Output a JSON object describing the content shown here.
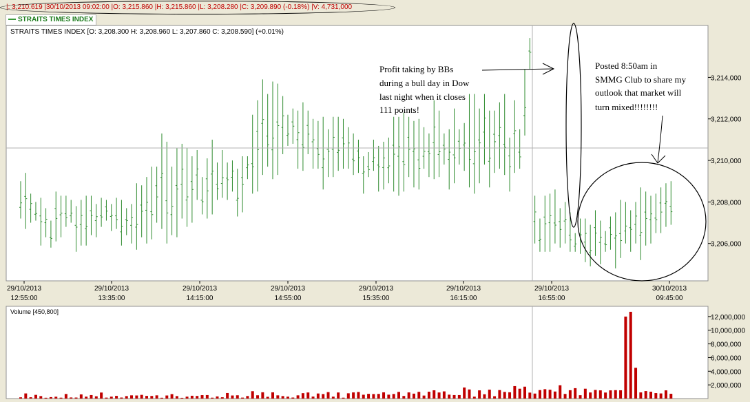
{
  "header": {
    "info_line": "|: 3,210.619 |30/10/2013 09:02:00 |O: 3,215.860 |H: 3,215.860 |L: 3,208.280 |C: 3,209.890 (-0.18%) |V: 4,731,000",
    "legend_tag": "STRAITS TIMES INDEX"
  },
  "price_panel": {
    "title": "STRAITS TIMES INDEX [O: 3,208.300  H: 3,208.960  L: 3,207.860  C: 3,208.590] (+0.01%)"
  },
  "volume_panel": {
    "title": "Volume [450,800]"
  },
  "annotations": {
    "left": [
      "Profit taking by BBs",
      "during a bull day in Dow",
      "last night when it closes",
      "111 points!"
    ],
    "right": [
      "Posted 8:50am in",
      "SMMG Club to share my",
      "outlook that market will",
      "turn mixed!!!!!!!!"
    ]
  },
  "colors": {
    "price_bar": "#2e8b2e",
    "volume_bar": "#c00000",
    "background": "#ffffff",
    "frame": "#ece9d8"
  },
  "chart_data": [
    {
      "type": "ohlc",
      "title": "STRAITS TIMES INDEX",
      "x_tick_labels": [
        [
          "29/10/2013",
          "12:55:00"
        ],
        [
          "29/10/2013",
          "13:35:00"
        ],
        [
          "29/10/2013",
          "14:15:00"
        ],
        [
          "29/10/2013",
          "14:55:00"
        ],
        [
          "29/10/2013",
          "15:35:00"
        ],
        [
          "29/10/2013",
          "16:15:00"
        ],
        [
          "29/10/2013",
          "16:55:00"
        ],
        [
          "30/10/2013",
          "09:45:00"
        ]
      ],
      "y_tick_labels": [
        "3,214,000",
        "3,212,000",
        "3,210,000",
        "3,208,000",
        "3,206,000"
      ],
      "y_ticks": [
        3214,
        3212,
        3210,
        3208,
        3206
      ],
      "ylim": [
        3204.2,
        3216.5
      ],
      "reference_line": 3210.6,
      "session_break_after_bar": 101,
      "highs": [
        3209.0,
        3209.4,
        3208.4,
        3208.0,
        3208.2,
        3207.7,
        3207.1,
        3208.5,
        3208.3,
        3208.3,
        3208.1,
        3207.8,
        3208.1,
        3208.3,
        3208.3,
        3207.9,
        3208.2,
        3208.1,
        3207.9,
        3208.2,
        3208.1,
        3207.7,
        3207.9,
        3208.9,
        3208.8,
        3209.2,
        3209.7,
        3209.7,
        3211.3,
        3210.9,
        3209.7,
        3210.6,
        3210.8,
        3210.6,
        3210.2,
        3210.5,
        3209.2,
        3210.1,
        3211.0,
        3209.9,
        3210.5,
        3209.9,
        3210.0,
        3209.6,
        3210.2,
        3210.2,
        3212.2,
        3212.9,
        3213.9,
        3213.2,
        3213.8,
        3213.7,
        3213.1,
        3212.2,
        3212.5,
        3212.4,
        3212.8,
        3212.4,
        3212.0,
        3211.9,
        3212.1,
        3211.5,
        3212.1,
        3212.1,
        3212.0,
        3211.6,
        3211.3,
        3211.0,
        3210.2,
        3210.4,
        3211.0,
        3210.7,
        3210.9,
        3211.1,
        3212.1,
        3212.1,
        3212.3,
        3212.1,
        3211.9,
        3212.0,
        3211.6,
        3211.3,
        3212.9,
        3212.4,
        3211.3,
        3211.5,
        3212.5,
        3211.5,
        3211.8,
        3213.2,
        3213.2,
        3212.5,
        3213.2,
        3212.4,
        3212.4,
        3212.8,
        3213.2,
        3211.1,
        3212.9,
        3211.5,
        3214.4,
        3215.9,
        3208.3,
        3207.2,
        3208.3,
        3208.4,
        3208.6,
        3207.7,
        3208.0,
        3207.5,
        3206.5,
        3207.2,
        3207.2,
        3206.9,
        3207.6,
        3207.1,
        3206.6,
        3207.3,
        3207.5,
        3208.1,
        3208.0,
        3207.6,
        3208.0,
        3208.7,
        3208.5,
        3208.3,
        3208.4,
        3208.7,
        3208.9,
        3209.0
      ],
      "lows": [
        3207.2,
        3206.7,
        3207.0,
        3207.1,
        3205.9,
        3206.3,
        3205.8,
        3206.1,
        3206.3,
        3206.8,
        3207.0,
        3205.6,
        3205.9,
        3205.9,
        3206.4,
        3206.3,
        3206.8,
        3207.1,
        3206.6,
        3206.7,
        3205.9,
        3206.4,
        3206.0,
        3205.7,
        3206.3,
        3206.0,
        3206.2,
        3207.0,
        3206.7,
        3206.0,
        3206.4,
        3206.3,
        3207.2,
        3206.8,
        3207.0,
        3208.1,
        3207.4,
        3207.2,
        3207.4,
        3208.1,
        3208.2,
        3208.1,
        3208.5,
        3207.3,
        3207.5,
        3209.1,
        3208.4,
        3208.5,
        3209.3,
        3209.7,
        3209.1,
        3209.3,
        3210.3,
        3210.7,
        3210.8,
        3209.6,
        3209.5,
        3210.3,
        3209.6,
        3209.6,
        3208.6,
        3209.2,
        3209.2,
        3209.5,
        3209.6,
        3209.6,
        3209.3,
        3209.4,
        3208.4,
        3209.2,
        3209.5,
        3208.5,
        3208.6,
        3208.9,
        3208.5,
        3208.3,
        3208.5,
        3209.2,
        3208.7,
        3208.6,
        3209.6,
        3209.2,
        3209.1,
        3209.2,
        3209.8,
        3208.6,
        3208.9,
        3209.8,
        3209.5,
        3208.7,
        3208.4,
        3208.9,
        3209.8,
        3208.7,
        3209.4,
        3209.6,
        3209.3,
        3208.5,
        3209.4,
        3209.6,
        3211.2,
        3214.4,
        3206.0,
        3205.6,
        3205.6,
        3205.6,
        3206.0,
        3205.8,
        3206.0,
        3205.6,
        3205.6,
        3205.5,
        3205.1,
        3204.9,
        3205.4,
        3205.0,
        3205.6,
        3205.7,
        3204.8,
        3205.3,
        3206.0,
        3205.6,
        3206.0,
        3205.2,
        3205.9,
        3206.0,
        3206.5,
        3206.5,
        3206.8,
        3206.9
      ],
      "volume": {
        "ylim": [
          0,
          13500000
        ],
        "y_ticks": [
          2000000,
          4000000,
          6000000,
          8000000,
          10000000,
          12000000
        ],
        "y_tick_labels": [
          "2,000,000",
          "4,000,000",
          "6,000,000",
          "8,000,000",
          "10,000,000",
          "12,000,000"
        ],
        "values": [
          180000,
          750000,
          190000,
          540000,
          360000,
          120000,
          210000,
          270000,
          130000,
          670000,
          160000,
          150000,
          610000,
          280000,
          510000,
          330000,
          880000,
          140000,
          280000,
          390000,
          150000,
          360000,
          470000,
          450000,
          540000,
          390000,
          380000,
          470000,
          120000,
          450000,
          650000,
          360000,
          110000,
          280000,
          410000,
          380000,
          500000,
          510000,
          130000,
          310000,
          190000,
          810000,
          450000,
          480000,
          140000,
          370000,
          1080000,
          480000,
          920000,
          260000,
          910000,
          470000,
          360000,
          280000,
          150000,
          470000,
          790000,
          890000,
          290000,
          740000,
          660000,
          940000,
          280000,
          890000,
          130000,
          770000,
          900000,
          960000,
          560000,
          690000,
          660000,
          680000,
          910000,
          570000,
          670000,
          970000,
          380000,
          900000,
          720000,
          980000,
          440000,
          1000000,
          1210000,
          890000,
          1050000,
          570000,
          510000,
          510000,
          1620000,
          1330000,
          280000,
          1200000,
          630000,
          1300000,
          340000,
          1240000,
          970000,
          920000,
          1820000,
          1440000,
          1740000,
          870000,
          730000,
          1240000,
          1370000,
          1290000,
          1030000,
          1950000,
          680000,
          1220000,
          1520000,
          490000,
          1440000,
          890000,
          1260000,
          1200000,
          880000,
          1200000,
          1230000,
          1210000,
          12000000,
          12700000,
          4500000,
          900000,
          1100000,
          1000000,
          800000,
          750000,
          1200000,
          700000
        ]
      }
    }
  ]
}
